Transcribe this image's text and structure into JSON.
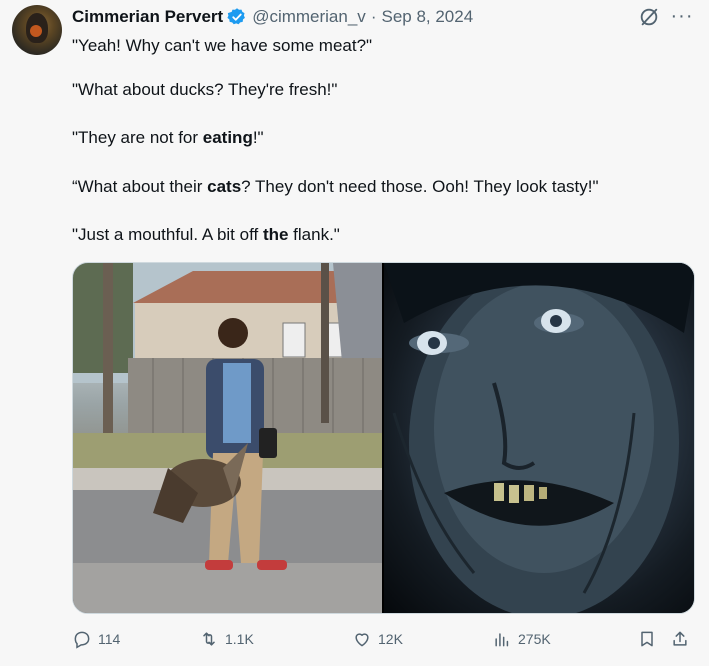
{
  "author": {
    "name": "Cimmerian Pervert",
    "handle": "@cimmerian_v",
    "separator": "·",
    "date": "Sep 8, 2024",
    "verified": true
  },
  "tweet": {
    "lines": [
      {
        "pre": "\"Yeah! Why can't we have some meat?\"",
        "bold": "",
        "post": ""
      },
      {
        "pre": "\"What about ducks? They're fresh!\"",
        "bold": "",
        "post": ""
      },
      {
        "pre": "\"They are not for ",
        "bold": "eating",
        "post": "!\""
      },
      {
        "pre": "“What about their ",
        "bold": "cats",
        "post": "? They don't need those. Ooh! They look tasty!\""
      },
      {
        "pre": "\"Just a mouthful. A bit off ",
        "bold": "the",
        "post": " flank.\""
      }
    ]
  },
  "media": {
    "left_image": "man-carrying-goose-photo",
    "right_image": "gollum-face-closeup"
  },
  "actions": {
    "replies": "114",
    "reposts": "1.1K",
    "likes": "12K",
    "views": "275K"
  },
  "colors": {
    "verified": "#1d9bf0",
    "secondary_text": "#536471",
    "background": "#f7f7f7"
  },
  "icons": [
    "verified-badge-icon",
    "grok-icon",
    "more-icon",
    "reply-icon",
    "repost-icon",
    "like-icon",
    "views-icon",
    "bookmark-icon",
    "share-icon"
  ]
}
